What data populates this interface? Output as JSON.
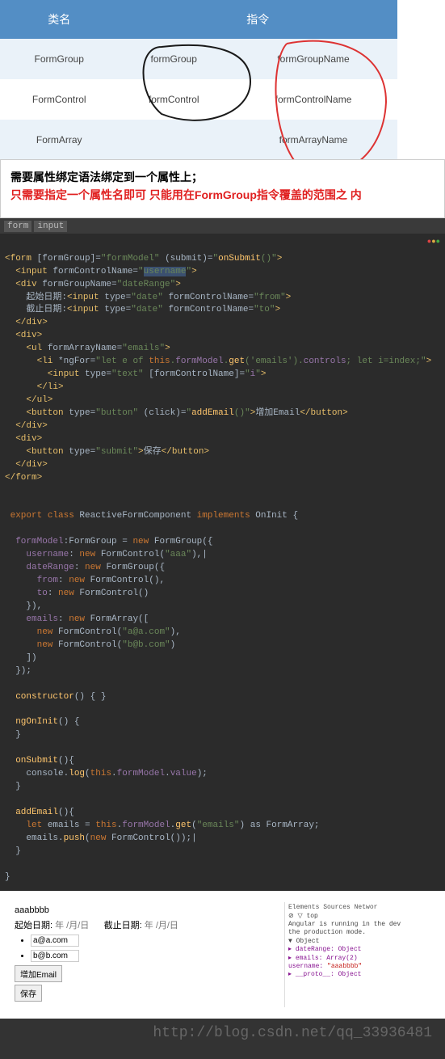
{
  "table": {
    "headers": [
      "类名",
      "指令"
    ],
    "rows": [
      [
        "FormGroup",
        "formGroup",
        "formGroupName"
      ],
      [
        "FormControl",
        "formControl",
        "formControlName"
      ],
      [
        "FormArray",
        "",
        "formArrayName"
      ]
    ]
  },
  "note": {
    "line1": "需要属性绑定语法绑定到一个属性上；",
    "line2": "只需要指定一个属性名即可 只能用在FormGroup指令覆盖的范围之 内"
  },
  "tabs": {
    "t1": "form",
    "t2": "input"
  },
  "code1": {
    "l1a": "<form",
    "l1b": " [formGroup]=",
    "l1c": "\"formModel\"",
    "l1d": " (submit)=",
    "l1e": "\"",
    "l1f": "onSubmit",
    "l1g": "()\"",
    "l1h": ">",
    "l2a": "  <input",
    "l2b": " formControlName=",
    "l2c": "\"",
    "l2d": "username",
    "l2e": "\"",
    "l2f": ">",
    "l3a": "  <div",
    "l3b": " formGroupName=",
    "l3c": "\"dateRange\"",
    "l3d": ">",
    "l4a": "    起始日期:",
    "l4b": "<input",
    "l4c": " type=",
    "l4d": "\"date\"",
    "l4e": " formControlName=",
    "l4f": "\"from\"",
    "l4g": ">",
    "l5a": "    截止日期:",
    "l5b": "<input",
    "l5c": " type=",
    "l5d": "\"date\"",
    "l5e": " formControlName=",
    "l5f": "\"to\"",
    "l5g": ">",
    "l6": "  </div>",
    "l7": "  <div>",
    "l8a": "    <ul",
    "l8b": " formArrayName=",
    "l8c": "\"emails\"",
    "l8d": ">",
    "l9a": "      <li",
    "l9b": " *ngFor=",
    "l9c": "\"let e of ",
    "l9d": "this",
    "l9e": ".",
    "l9f": "formModel",
    "l9g": ".",
    "l9h": "get",
    "l9i": "(",
    "l9j": "'emails'",
    "l9k": ").",
    "l9l": "controls",
    "l9m": "; let i=index;\"",
    "l9n": ">",
    "l10a": "        <input",
    "l10b": " type=",
    "l10c": "\"text\"",
    "l10d": " [formControlName]=",
    "l10e": "\"",
    "l10f": "i",
    "l10g": "\"",
    "l10h": ">",
    "l11": "      </li>",
    "l12": "    </ul>",
    "l13a": "    <button",
    "l13b": " type=",
    "l13c": "\"button\"",
    "l13d": " (click)=",
    "l13e": "\"",
    "l13f": "addEmail",
    "l13g": "()\"",
    "l13h": ">",
    "l13i": "增加Email",
    "l13j": "</button>",
    "l14": "  </div>",
    "l15": "  <div>",
    "l16a": "    <button",
    "l16b": " type=",
    "l16c": "\"submit\"",
    "l16d": ">",
    "l16e": "保存",
    "l16f": "</button>",
    "l17": "  </div>",
    "l18": "</form>"
  },
  "code2": {
    "l1a": " export",
    "l1b": " class",
    "l1c": " ReactiveFormComponent ",
    "l1d": "implements",
    "l1e": " OnInit {",
    "l2a": "  formModel",
    "l2b": ":FormGroup = ",
    "l2c": "new",
    "l2d": " FormGroup({",
    "l3a": "    username",
    "l3b": ": ",
    "l3c": "new",
    "l3d": " FormControl(",
    "l3e": "\"aaa\"",
    "l3f": "),|",
    "l4a": "    dateRange",
    "l4b": ": ",
    "l4c": "new",
    "l4d": " FormGroup({",
    "l5a": "      from",
    "l5b": ": ",
    "l5c": "new",
    "l5d": " FormControl(),",
    "l6a": "      to",
    "l6b": ": ",
    "l6c": "new",
    "l6d": " FormControl()",
    "l7": "    }),",
    "l8a": "    emails",
    "l8b": ": ",
    "l8c": "new",
    "l8d": " FormArray([",
    "l9a": "      new",
    "l9b": " FormControl(",
    "l9c": "\"a@a.com\"",
    "l9d": "),",
    "l10a": "      new",
    "l10b": " FormControl(",
    "l10c": "\"b@b.com\"",
    "l10d": ")     ",
    "l11": "    ])",
    "l12": "  });",
    "l13a": "  constructor",
    "l13b": "() { }",
    "l14a": "  ngOnInit",
    "l14b": "() {",
    "l15": "  }",
    "l16a": "  onSubmit",
    "l16b": "(){",
    "l17a": "    console.",
    "l17b": "log",
    "l17c": "(",
    "l17d": "this",
    "l17e": ".",
    "l17f": "formModel",
    "l17g": ".",
    "l17h": "value",
    "l17i": ");",
    "l18": "  }",
    "l19a": "  addEmail",
    "l19b": "(){",
    "l20a": "    let",
    "l20b": " emails = ",
    "l20c": "this",
    "l20d": ".",
    "l20e": "formModel",
    "l20f": ".",
    "l20g": "get",
    "l20h": "(",
    "l20i": "\"emails\"",
    "l20j": ") as FormArray;",
    "l21a": "    emails.",
    "l21b": "push",
    "l21c": "(",
    "l21d": "new",
    "l21e": " FormControl());|",
    "l22": "  }",
    "l23": "}"
  },
  "preview": {
    "username": "aaabbbb",
    "startLabel": "起始日期:",
    "endLabel": "截止日期:",
    "datePlaceholder": "年 /月/日",
    "email1": "a@a.com",
    "email2": "b@b.com",
    "addBtn": "增加Email",
    "saveBtn": "保存"
  },
  "devtools": {
    "tabs": "Elements  Sources  Networ",
    "filterIcons": "⊘ ▽ top",
    "msg1": "Angular is running in the dev",
    "msg2": "the production mode.",
    "obj": "▼ Object",
    "dateRange": "  ▸ dateRange: Object",
    "emails": "  ▸ emails: Array(2)",
    "username": "    username: ",
    "usernameVal": "\"aaabbbb\"",
    "proto": "  ▸ __proto__: Object"
  },
  "watermark": "http://blog.csdn.net/qq_33936481"
}
